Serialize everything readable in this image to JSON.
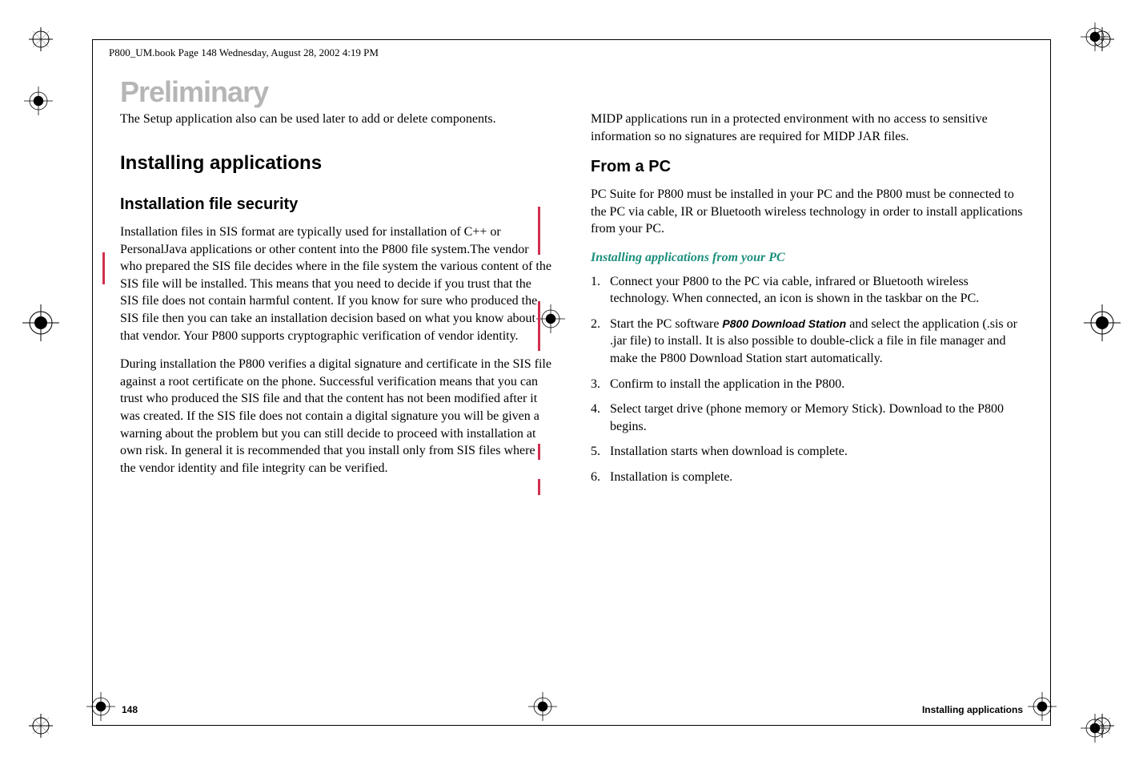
{
  "header": "P800_UM.book  Page 148  Wednesday, August 28, 2002  4:19 PM",
  "watermark": "Preliminary",
  "left": {
    "intro": "The Setup application also can be used later to add or delete components.",
    "h1": "Installing applications",
    "h2": "Installation file security",
    "p1": "Installation files in SIS format are typically used for installation of C++ or PersonalJava applications or other content into the P800 file system.The vendor who prepared the SIS file decides where in the file system the various content of the SIS file will be installed. This means that you need to decide if you trust that the SIS file does not contain harmful content. If you know for sure who produced the SIS file then you can take an installation decision based on what you know about that vendor. Your P800 supports cryptographic verification of vendor identity.",
    "p2": "During installation the P800 verifies a digital signature and certificate in the SIS file against a root certificate on the phone. Successful verification means that you can trust who produced the SIS file and that the content has not been modified after it was created. If the SIS file does not contain a digital signature you will be given a warning about the problem but you can still decide to proceed with installation at own risk. In general it is recommended that you install only from SIS files where the vendor identity and file integrity can be verified."
  },
  "right": {
    "p1": "MIDP applications run in a protected environment with no access to sensitive information so no signatures are required for MIDP JAR files.",
    "h2": "From a PC",
    "p2": "PC Suite for P800 must be installed in your PC and the P800 must be connected to the PC via cable, IR or Bluetooth wireless technology in order to install applications from your PC.",
    "h3": "Installing applications from your PC",
    "step1": "Connect your P800 to the PC via cable, infrared or Bluetooth wireless technology. When connected, an icon is shown in the taskbar on the PC.",
    "step2a": "Start the PC software ",
    "step2bold": "P800 Download Station",
    "step2b": " and select the application (.sis or .jar file) to install. It is also possible to double-click a file in file manager and make the P800 Download Station start automatically.",
    "step3": "Confirm to install the application in the P800.",
    "step4": "Select target drive (phone memory or Memory Stick). Download to the P800 begins.",
    "step5": "Installation starts when download is complete.",
    "step6": "Installation is complete."
  },
  "footer": {
    "page": "148",
    "section": "Installing applications"
  }
}
